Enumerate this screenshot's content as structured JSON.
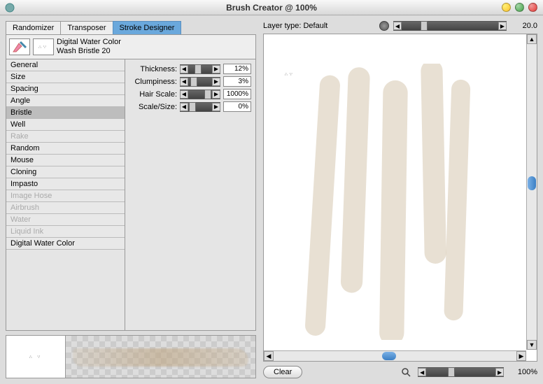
{
  "window": {
    "title": "Brush Creator @ 100%"
  },
  "tabs": {
    "randomizer": "Randomizer",
    "transposer": "Transposer",
    "stroke_designer": "Stroke Designer"
  },
  "brush": {
    "category": "Digital Water Color",
    "variant": "Wash Bristle 20"
  },
  "categories": [
    {
      "label": "General",
      "disabled": false
    },
    {
      "label": "Size",
      "disabled": false
    },
    {
      "label": "Spacing",
      "disabled": false
    },
    {
      "label": "Angle",
      "disabled": false
    },
    {
      "label": "Bristle",
      "disabled": false,
      "selected": true
    },
    {
      "label": "Well",
      "disabled": false
    },
    {
      "label": "Rake",
      "disabled": true
    },
    {
      "label": "Random",
      "disabled": false
    },
    {
      "label": "Mouse",
      "disabled": false
    },
    {
      "label": "Cloning",
      "disabled": false
    },
    {
      "label": "Impasto",
      "disabled": false
    },
    {
      "label": "Image Hose",
      "disabled": true
    },
    {
      "label": "Airbrush",
      "disabled": true
    },
    {
      "label": "Water",
      "disabled": true
    },
    {
      "label": "Liquid Ink",
      "disabled": true
    },
    {
      "label": "Digital Water Color",
      "disabled": false
    }
  ],
  "params": {
    "thickness": {
      "label": "Thickness:",
      "value": "12%"
    },
    "clumpiness": {
      "label": "Clumpiness:",
      "value": "3%"
    },
    "hair_scale": {
      "label": "Hair Scale:",
      "value": "1000%"
    },
    "scale_size": {
      "label": "Scale/Size:",
      "value": "0%"
    }
  },
  "right": {
    "layer_type": "Layer type: Default",
    "size_value": "20.0",
    "zoom_value": "100%",
    "clear": "Clear"
  }
}
